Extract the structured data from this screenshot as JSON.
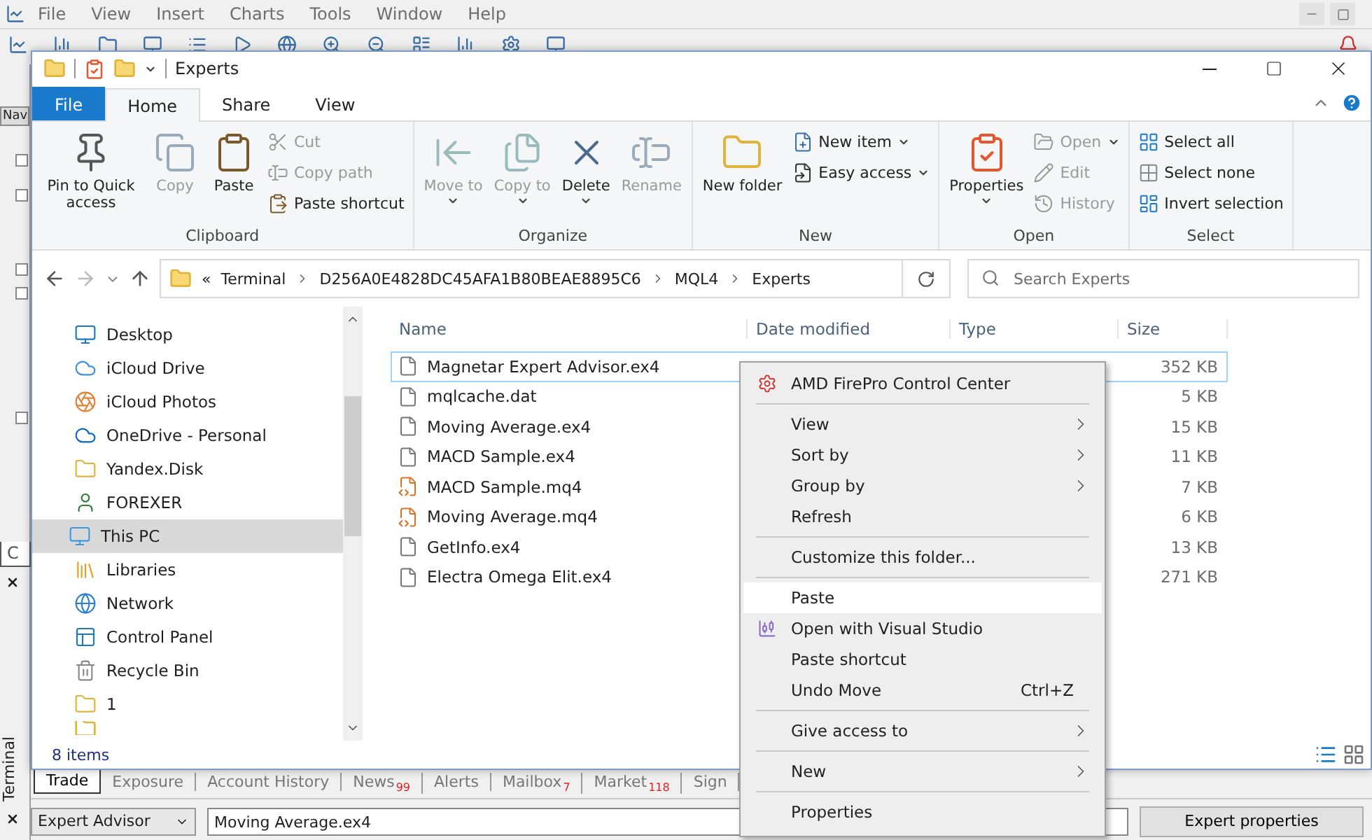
{
  "app": {
    "menu": [
      "File",
      "View",
      "Insert",
      "Charts",
      "Tools",
      "Window",
      "Help"
    ],
    "navigator_header": "Nav",
    "navigator_tab": "C",
    "terminal_label": "Terminal",
    "terminal_tabs": [
      {
        "label": "Trade",
        "selected": true
      },
      {
        "label": "Exposure",
        "selected": false
      },
      {
        "label": "Account History",
        "selected": false
      },
      {
        "label": "News",
        "badge": "99",
        "selected": false
      },
      {
        "label": "Alerts",
        "selected": false
      },
      {
        "label": "Mailbox",
        "badge": "7",
        "selected": false
      },
      {
        "label": "Market",
        "badge": "118",
        "selected": false
      },
      {
        "label": "Sign",
        "selected": false
      }
    ],
    "expert_select": "Expert Advisor",
    "expert_field": "Moving Average.ex4",
    "expert_button": "Expert properties"
  },
  "window": {
    "title": "Experts",
    "ribbon_tabs": [
      {
        "label": "File",
        "kind": "file",
        "selected": false
      },
      {
        "label": "Home",
        "kind": "tab",
        "selected": true
      },
      {
        "label": "Share",
        "kind": "tab",
        "selected": false
      },
      {
        "label": "View",
        "kind": "tab",
        "selected": false
      }
    ],
    "ribbon_groups": [
      {
        "label": "Clipboard",
        "large": [
          {
            "label": "Pin to Quick access",
            "kind": "pin",
            "disabled": false,
            "menu": false
          },
          {
            "label": "Copy",
            "kind": "copy",
            "disabled": true,
            "menu": false
          },
          {
            "label": "Paste",
            "kind": "paste",
            "disabled": false,
            "menu": false
          }
        ],
        "small": [
          {
            "label": "Cut",
            "kind": "cut",
            "disabled": true,
            "menu": false
          },
          {
            "label": "Copy path",
            "kind": "path",
            "disabled": true,
            "menu": false
          },
          {
            "label": "Paste shortcut",
            "kind": "shortcut",
            "disabled": false,
            "menu": false
          }
        ]
      },
      {
        "label": "Organize",
        "large": [
          {
            "label": "Move to",
            "kind": "move",
            "disabled": true,
            "menu": true
          },
          {
            "label": "Copy to",
            "kind": "copyto",
            "disabled": true,
            "menu": true
          },
          {
            "label": "Delete",
            "kind": "delete",
            "disabled": false,
            "menu": true
          },
          {
            "label": "Rename",
            "kind": "rename",
            "disabled": true,
            "menu": false
          }
        ]
      },
      {
        "label": "New",
        "large": [
          {
            "label": "New folder",
            "kind": "folder",
            "disabled": false,
            "menu": false
          }
        ],
        "small": [
          {
            "label": "New item",
            "kind": "newitem",
            "disabled": false,
            "menu": true
          },
          {
            "label": "Easy access",
            "kind": "easy",
            "disabled": false,
            "menu": true
          }
        ]
      },
      {
        "label": "Open",
        "large": [
          {
            "label": "Properties",
            "kind": "properties",
            "disabled": false,
            "menu": true
          }
        ],
        "small": [
          {
            "label": "Open",
            "kind": "open",
            "disabled": true,
            "menu": true
          },
          {
            "label": "Edit",
            "kind": "edit",
            "disabled": true,
            "menu": false
          },
          {
            "label": "History",
            "kind": "history",
            "disabled": true,
            "menu": false
          }
        ]
      },
      {
        "label": "Select",
        "small": [
          {
            "label": "Select all",
            "kind": "all",
            "disabled": false,
            "menu": false
          },
          {
            "label": "Select none",
            "kind": "none",
            "disabled": false,
            "menu": false
          },
          {
            "label": "Invert selection",
            "kind": "invert",
            "disabled": false,
            "menu": false
          }
        ]
      }
    ],
    "address": {
      "overflow": "«",
      "crumbs": [
        "Terminal",
        "D256A0E4828DC45AFA1B80BEAE8895C6",
        "MQL4",
        "Experts"
      ]
    },
    "search": {
      "placeholder": "Search Experts"
    },
    "nav_items": [
      {
        "label": "Desktop",
        "kind": "desktop",
        "selected": false
      },
      {
        "label": "iCloud Drive",
        "kind": "cloud",
        "selected": false
      },
      {
        "label": "iCloud Photos",
        "kind": "photos",
        "selected": false
      },
      {
        "label": "OneDrive - Personal",
        "kind": "onedrive",
        "selected": false
      },
      {
        "label": "Yandex.Disk",
        "kind": "yandex",
        "selected": false
      },
      {
        "label": "FOREXER",
        "kind": "user",
        "selected": false
      },
      {
        "label": "This PC",
        "kind": "pc",
        "selected": true
      },
      {
        "label": "Libraries",
        "kind": "libraries",
        "selected": false
      },
      {
        "label": "Network",
        "kind": "network",
        "selected": false
      },
      {
        "label": "Control Panel",
        "kind": "control",
        "selected": false
      },
      {
        "label": "Recycle Bin",
        "kind": "recycle",
        "selected": false
      },
      {
        "label": "1",
        "kind": "folder",
        "selected": false
      }
    ],
    "columns": [
      "Name",
      "Date modified",
      "Type",
      "Size"
    ],
    "files": [
      {
        "name": "Magnetar Expert Advisor.ex4",
        "size": "352 KB",
        "kind": "plain",
        "focused": true
      },
      {
        "name": "mqlcache.dat",
        "size": "5 KB",
        "kind": "plain",
        "focused": false
      },
      {
        "name": "Moving Average.ex4",
        "size": "15 KB",
        "kind": "plain",
        "focused": false
      },
      {
        "name": "MACD Sample.ex4",
        "size": "11 KB",
        "kind": "plain",
        "focused": false
      },
      {
        "name": "MACD Sample.mq4",
        "size": "7 KB",
        "kind": "source",
        "focused": false
      },
      {
        "name": "Moving Average.mq4",
        "size": "6 KB",
        "kind": "source",
        "focused": false
      },
      {
        "name": "GetInfo.ex4",
        "size": "13 KB",
        "kind": "plain",
        "focused": false
      },
      {
        "name": "Electra Omega Elit.ex4",
        "size": "271 KB",
        "kind": "plain",
        "focused": false
      }
    ],
    "status": "8 items"
  },
  "context_menu": [
    {
      "kind": "item",
      "label": "AMD FirePro Control Center",
      "submenu": false,
      "highlighted": false
    },
    {
      "kind": "separator"
    },
    {
      "kind": "item",
      "label": "View",
      "submenu": true,
      "highlighted": false
    },
    {
      "kind": "item",
      "label": "Sort by",
      "submenu": true,
      "highlighted": false
    },
    {
      "kind": "item",
      "label": "Group by",
      "submenu": true,
      "highlighted": false
    },
    {
      "kind": "item",
      "label": "Refresh",
      "submenu": false,
      "highlighted": false
    },
    {
      "kind": "separator"
    },
    {
      "kind": "item",
      "label": "Customize this folder...",
      "submenu": false,
      "highlighted": false
    },
    {
      "kind": "separator"
    },
    {
      "kind": "item",
      "label": "Paste",
      "submenu": false,
      "highlighted": true
    },
    {
      "kind": "item",
      "label": "Open with Visual Studio",
      "submenu": false,
      "highlighted": false
    },
    {
      "kind": "item",
      "label": "Paste shortcut",
      "submenu": false,
      "highlighted": false
    },
    {
      "kind": "item",
      "label": "Undo Move",
      "submenu": false,
      "shortcut": "Ctrl+Z",
      "highlighted": false
    },
    {
      "kind": "separator"
    },
    {
      "kind": "item",
      "label": "Give access to",
      "submenu": true,
      "highlighted": false
    },
    {
      "kind": "separator"
    },
    {
      "kind": "item",
      "label": "New",
      "submenu": true,
      "highlighted": false
    },
    {
      "kind": "separator"
    },
    {
      "kind": "item",
      "label": "Properties",
      "submenu": false,
      "highlighted": false
    }
  ]
}
